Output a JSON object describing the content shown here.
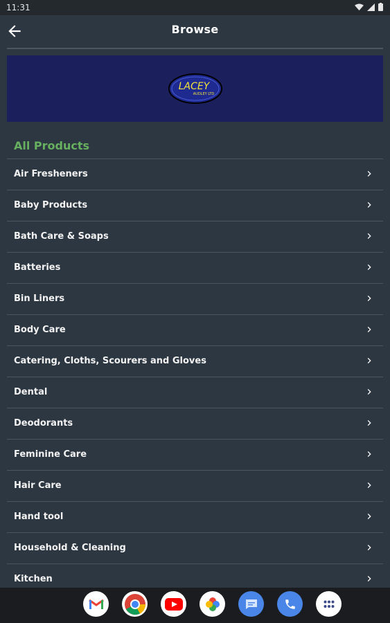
{
  "status": {
    "time": "11:31"
  },
  "header": {
    "title": "Browse"
  },
  "banner": {
    "logo_text": "LACEY",
    "logo_subtext": "AUDLEY LTD"
  },
  "section": {
    "title": "All Products"
  },
  "categories": [
    "Air Fresheners",
    "Baby Products",
    "Bath Care & Soaps",
    "Batteries",
    "Bin Liners",
    "Body Care",
    "Catering, Cloths, Scourers and Gloves",
    "Dental",
    "Deodorants",
    "Feminine Care",
    "Hair Care",
    "Hand tool",
    "Household & Cleaning",
    "Kitchen"
  ],
  "dock_apps": [
    "gmail-icon",
    "chrome-icon",
    "youtube-icon",
    "photos-icon",
    "messages-icon",
    "phone-icon",
    "app-drawer-icon"
  ],
  "colors": {
    "background": "#2d3742",
    "accent": "#67b05f",
    "banner": "#1b1f5c"
  }
}
